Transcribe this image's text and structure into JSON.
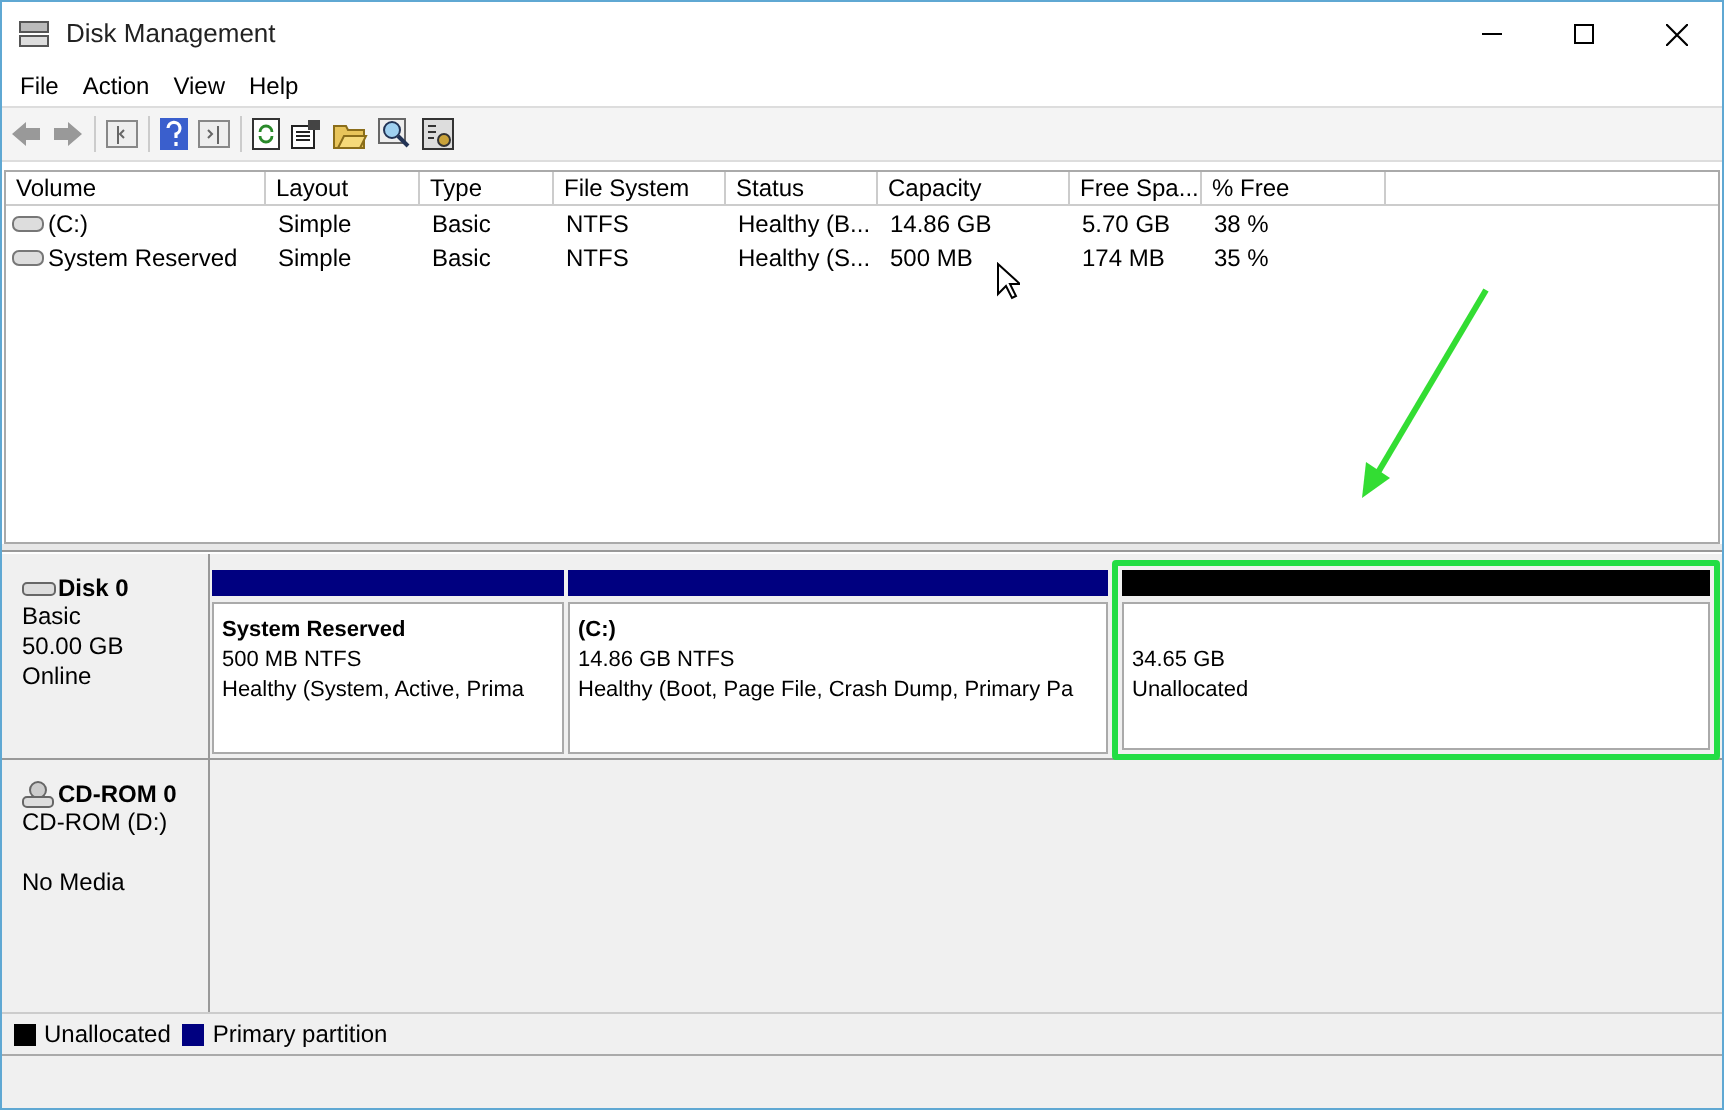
{
  "window": {
    "title": "Disk Management"
  },
  "menu": [
    "File",
    "Action",
    "View",
    "Help"
  ],
  "table": {
    "columns": [
      "Volume",
      "Layout",
      "Type",
      "File System",
      "Status",
      "Capacity",
      "Free Spa...",
      "% Free"
    ],
    "rows": [
      {
        "cells": [
          "(C:)",
          "Simple",
          "Basic",
          "NTFS",
          "Healthy (B...",
          "14.86 GB",
          "5.70 GB",
          "38 %"
        ]
      },
      {
        "cells": [
          "System Reserved",
          "Simple",
          "Basic",
          "NTFS",
          "Healthy (S...",
          "500 MB",
          "174 MB",
          "35 %"
        ]
      }
    ]
  },
  "disks": [
    {
      "kind": "disk",
      "name": "Disk 0",
      "lines": [
        "Basic",
        "50.00 GB",
        "Online"
      ],
      "partitions": [
        {
          "color": "#000080",
          "name": "System Reserved",
          "lines": [
            "500 MB NTFS",
            "Healthy (System, Active, Prima"
          ],
          "highlighted": false
        },
        {
          "color": "#000080",
          "name": "(C:)",
          "lines": [
            "14.86 GB NTFS",
            "Healthy (Boot, Page File, Crash Dump, Primary Pa"
          ],
          "highlighted": false
        },
        {
          "color": "#000000",
          "lines": [
            "34.65 GB",
            "Unallocated"
          ],
          "highlighted": true
        }
      ]
    },
    {
      "kind": "cdrom",
      "name": "CD-ROM 0",
      "lines": [
        "CD-ROM (D:)",
        "No Media"
      ]
    }
  ],
  "legend": [
    {
      "label": "Unallocated",
      "color": "#000000"
    },
    {
      "label": "Primary partition",
      "color": "#000080"
    }
  ]
}
